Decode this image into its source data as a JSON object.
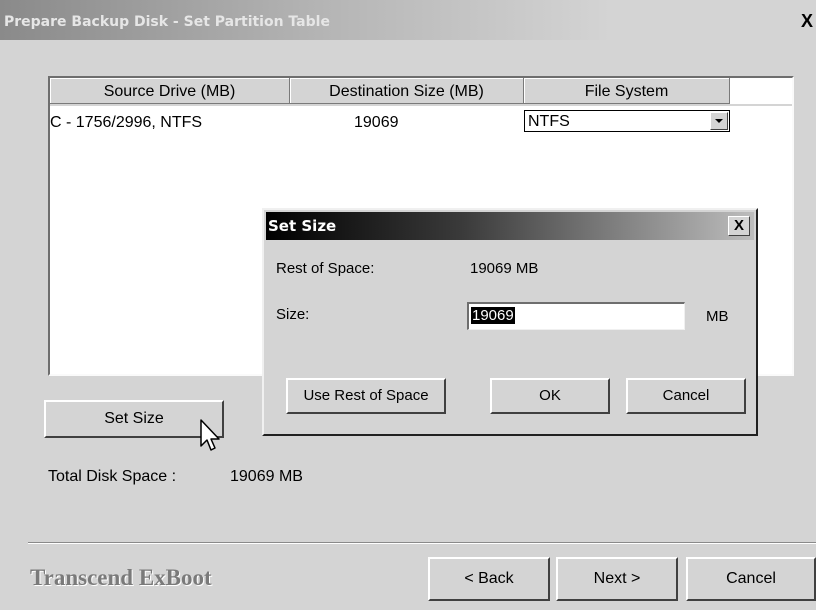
{
  "window": {
    "title": "Prepare Backup Disk - Set Partition Table",
    "close_glyph": "X"
  },
  "table": {
    "columns": [
      "Source Drive (MB)",
      "Destination Size (MB)",
      "File System"
    ],
    "rows": [
      {
        "source": "C - 1756/2996, NTFS",
        "destination": "19069",
        "file_system": "NTFS"
      }
    ]
  },
  "set_size_button": "Set Size",
  "total": {
    "label": "Total Disk Space :",
    "value": "19069 MB"
  },
  "footer": {
    "brand": "Transcend ExBoot",
    "back": "< Back",
    "next": "Next >",
    "cancel": "Cancel"
  },
  "dialog": {
    "title": "Set Size",
    "close_glyph": "X",
    "rest_label": "Rest of Space:",
    "rest_value": "19069 MB",
    "size_label": "Size:",
    "size_value": "19069",
    "size_unit": "MB",
    "use_rest_button": "Use Rest of Space",
    "ok_button": "OK",
    "cancel_button": "Cancel"
  }
}
